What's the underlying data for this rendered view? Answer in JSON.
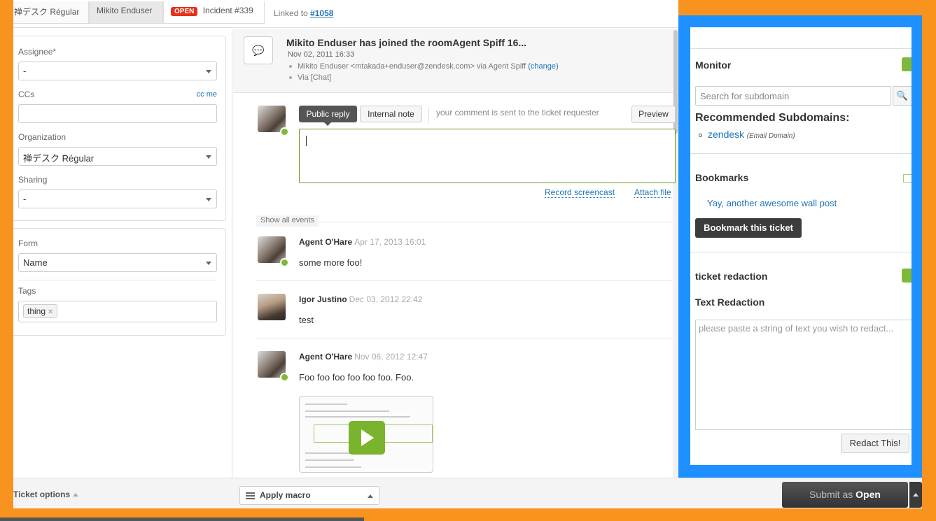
{
  "topbar": {
    "tab_org": "禅デスク Régular",
    "tab_user": "Mikito Enduser",
    "tab_status": "OPEN",
    "tab_incident": "Incident #339",
    "linked_label": "Linked to",
    "linked_ticket": "#1058"
  },
  "sidebar": {
    "assignee_label": "Assignee*",
    "assignee_value": "-",
    "ccs_label": "CCs",
    "ccme_label": "cc me",
    "organization_label": "Organization",
    "organization_value": "禅デスク Régular",
    "sharing_label": "Sharing",
    "sharing_value": "-",
    "form_label": "Form",
    "form_value": "Name",
    "tags_label": "Tags",
    "tags": [
      "thing"
    ]
  },
  "conversation": {
    "chat_title": "Mikito Enduser has joined the roomAgent Spiff 16...",
    "chat_date": "Nov 02, 2011 16:33",
    "chat_via": "Mikito Enduser <mtakada+enduser@zendesk.com> via Agent Spiff",
    "chat_change": "(change)",
    "chat_channel": "Via [Chat]",
    "public_reply": "Public reply",
    "internal_note": "Internal note",
    "reply_hint": "your comment is sent to the ticket requester",
    "preview": "Preview",
    "record_screencast": "Record screencast",
    "attach_file": "Attach file",
    "show_all_events": "Show all events",
    "events": [
      {
        "author": "Agent O'Hare",
        "date": "Apr 17, 2013 16:01",
        "body": "some more foo!"
      },
      {
        "author": "Igor Justino",
        "date": "Dec 03, 2012 22:42",
        "body": "test"
      },
      {
        "author": "Agent O'Hare",
        "date": "Nov 06, 2012 12:47",
        "body": "Foo foo foo foo foo foo. Foo."
      }
    ]
  },
  "apps": {
    "monitor_title": "Monitor",
    "search_placeholder": "Search for subdomain",
    "recommended_heading": "Recommended Subdomains:",
    "recommended_item": "zendesk",
    "recommended_note": "(Email Domain)",
    "bookmarks_title": "Bookmarks",
    "bookmark_link": "Yay, another awesome wall post",
    "bookmark_button": "Bookmark this ticket",
    "redaction_title": "ticket redaction",
    "text_redaction_heading": "Text Redaction",
    "redaction_placeholder": "please paste a string of text you wish to redact...",
    "redact_button": "Redact This!"
  },
  "footer": {
    "ticket_options": "Ticket options",
    "apply_macro": "Apply macro",
    "submit_prefix": "Submit as",
    "submit_status": "Open"
  },
  "colors": {
    "highlight_orange": "#f99320",
    "highlight_blue": "#1e90ff",
    "link_blue": "#1f73b7",
    "status_red": "#e6311a",
    "agent_green": "#7fb93a"
  }
}
